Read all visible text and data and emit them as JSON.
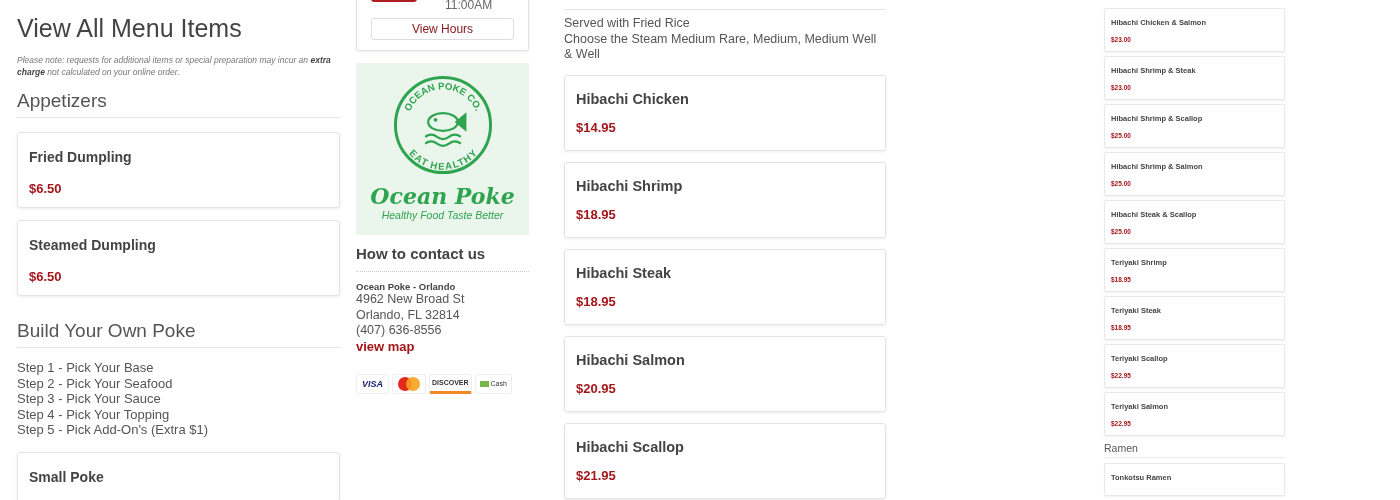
{
  "left": {
    "title": "View All Menu Items",
    "note": "Please note: requests for additional items or special preparation may incur an **extra charge** not calculated on your online order.",
    "blocks": [
      {
        "kind": "heading",
        "text": "Appetizers"
      },
      {
        "kind": "item",
        "name": "Fried Dumpling",
        "price": "$6.50"
      },
      {
        "kind": "item",
        "name": "Steamed Dumpling",
        "price": "$6.50"
      },
      {
        "kind": "heading",
        "text": "Build Your Own Poke"
      },
      {
        "kind": "steps",
        "lines": [
          "Step 1 - Pick Your Base",
          "Step 2 - Pick Your Seafood",
          "Step 3 - Pick Your Sauce",
          "Step 4 - Pick Your Topping",
          "Step 5 - Pick Add-On's (Extra $1)"
        ]
      },
      {
        "kind": "item",
        "name": "Small Poke"
      }
    ]
  },
  "hours": {
    "time": "11:00AM",
    "button": "View Hours"
  },
  "logo": {
    "ring_top": "OCEAN POKE CO.",
    "ring_bottom": "EAT HEALTHY",
    "name": "Ocean Poke",
    "tagline": "Healthy Food Taste Better"
  },
  "contact": {
    "heading": "How to contact us",
    "name": "Ocean Poke - Orlando",
    "lines": [
      "4962 New Broad St",
      "Orlando, FL 32814",
      "(407) 636-8556"
    ],
    "map_link": "view map"
  },
  "payments": [
    {
      "kind": "visa",
      "label": "VISA"
    },
    {
      "kind": "mastercard"
    },
    {
      "kind": "discover",
      "label": "DISCOVER"
    },
    {
      "kind": "cash",
      "label": "Cash"
    }
  ],
  "center": {
    "description": [
      "Served with Fried Rice",
      "Choose the Steam Medium Rare, Medium, Medium Well & Well"
    ],
    "items": [
      {
        "name": "Hibachi Chicken",
        "price": "$14.95"
      },
      {
        "name": "Hibachi Shrimp",
        "price": "$18.95"
      },
      {
        "name": "Hibachi Steak",
        "price": "$18.95"
      },
      {
        "name": "Hibachi Salmon",
        "price": "$20.95"
      },
      {
        "name": "Hibachi Scallop",
        "price": "$21.95"
      }
    ]
  },
  "right": {
    "blocks": [
      {
        "kind": "item",
        "name": "Hibachi Chicken & Salmon",
        "price": "$23.00"
      },
      {
        "kind": "item",
        "name": "Hibachi Shrimp & Steak",
        "price": "$23.00"
      },
      {
        "kind": "item",
        "name": "Hibachi Shrimp & Scallop",
        "price": "$25.00"
      },
      {
        "kind": "item",
        "name": "Hibachi Shrimp & Salmon",
        "price": "$25.00"
      },
      {
        "kind": "item",
        "name": "Hibachi Steak & Scallop",
        "price": "$25.00"
      },
      {
        "kind": "item",
        "name": "Teriyaki Shrimp",
        "price": "$18.95"
      },
      {
        "kind": "item",
        "name": "Teriyaki Steak",
        "price": "$18.95"
      },
      {
        "kind": "item",
        "name": "Teriyaki Scallop",
        "price": "$22.95"
      },
      {
        "kind": "item",
        "name": "Teriyaki Salmon",
        "price": "$22.95"
      },
      {
        "kind": "heading",
        "text": "Ramen"
      },
      {
        "kind": "item",
        "name": "Tonkotsu Ramen"
      }
    ]
  }
}
